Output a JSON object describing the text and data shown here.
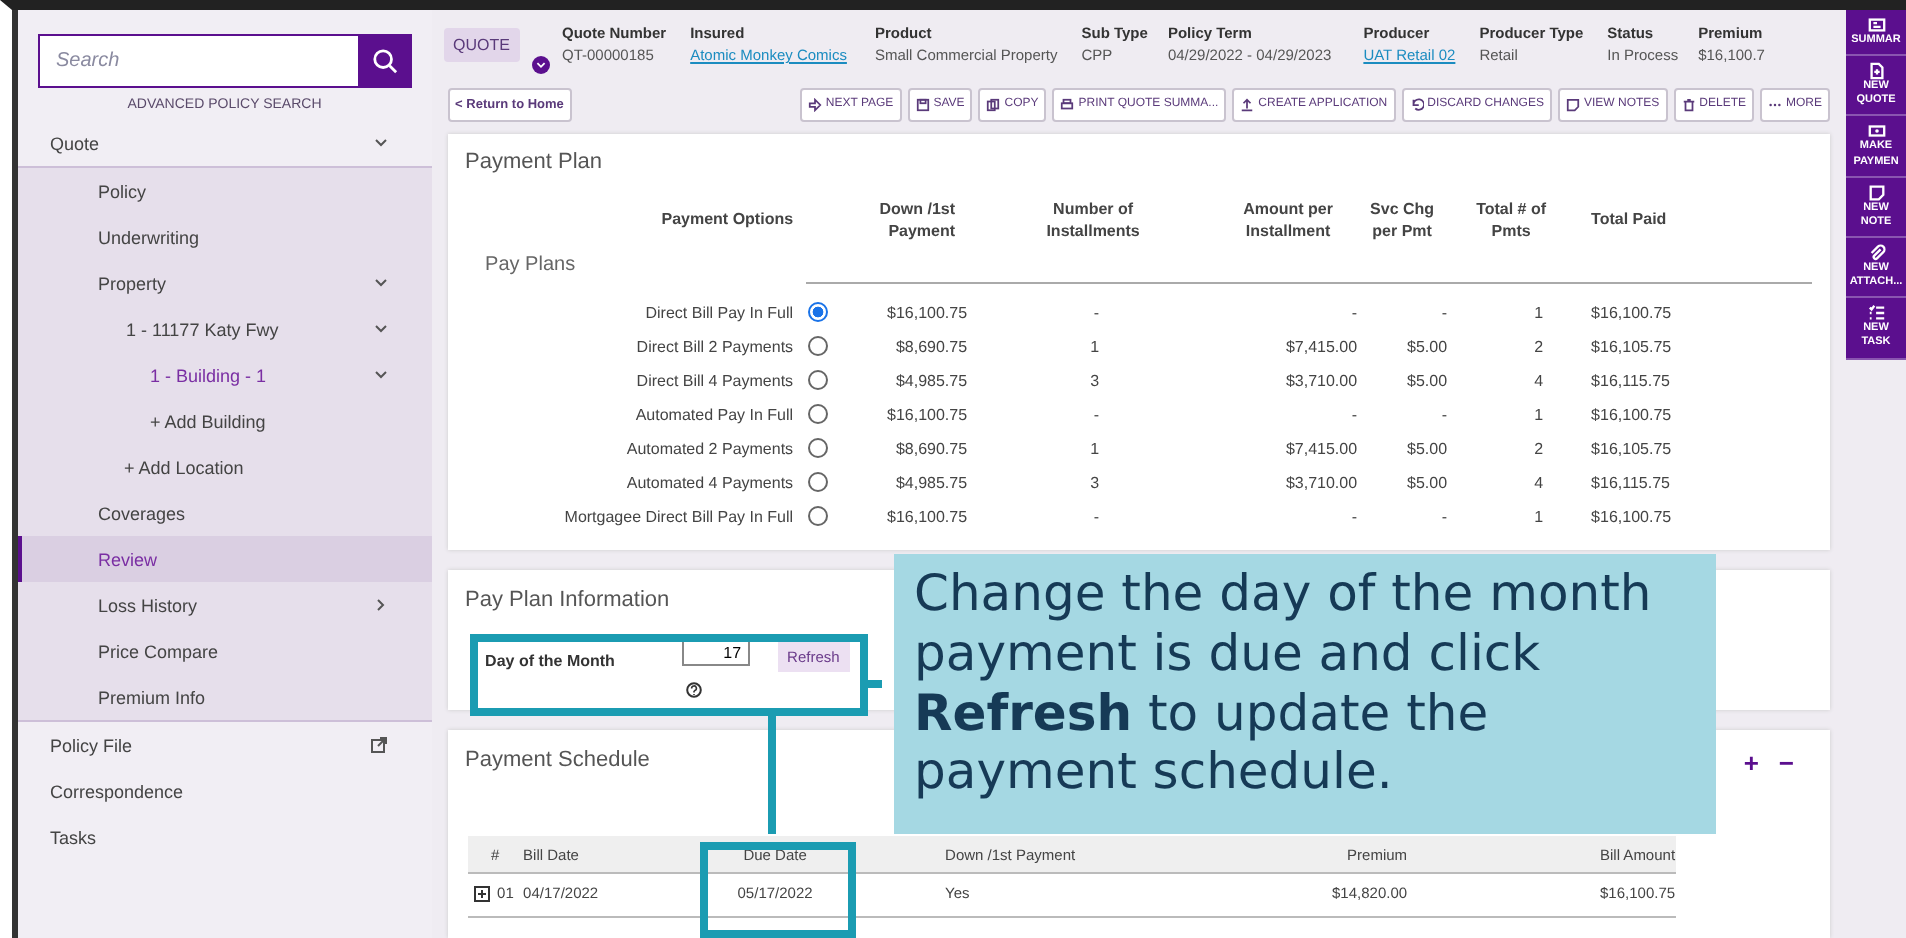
{
  "sidebar": {
    "search": {
      "placeholder": "Search"
    },
    "advanced_search": "ADVANCED POLICY SEARCH",
    "items": [
      {
        "label": "Quote",
        "expanded": true,
        "children": [
          {
            "label": "Policy",
            "selected": false
          },
          {
            "label": "Underwriting",
            "selected": false
          },
          {
            "label": "Property",
            "selected": false,
            "expanded": true,
            "children": [
              {
                "label": "1 - 11177 Katy Fwy",
                "selected": false,
                "expanded": true,
                "children": [
                  {
                    "label": "1 - Building - 1",
                    "selected": false,
                    "current": true,
                    "expanded": true
                  },
                  {
                    "label": "+ Add Building",
                    "selected": false,
                    "current": false
                  }
                ]
              },
              {
                "label": "+ Add Location",
                "selected": false
              }
            ]
          },
          {
            "label": "Coverages",
            "selected": false
          },
          {
            "label": "Review",
            "selected": true
          },
          {
            "label": "Loss History",
            "selected": false,
            "expanded": false
          },
          {
            "label": "Price Compare",
            "selected": false
          },
          {
            "label": "Premium Info",
            "selected": false
          }
        ]
      },
      {
        "label": "Policy File",
        "kind": "external"
      },
      {
        "label": "Correspondence",
        "kind": "plain"
      },
      {
        "label": "Tasks",
        "kind": "plain"
      }
    ]
  },
  "header": {
    "tag": "QUOTE",
    "fields": [
      {
        "label": "Quote Number",
        "value": "QT-00000185",
        "kind": "text"
      },
      {
        "label": "Insured",
        "value": "Atomic Monkey Comics",
        "kind": "link"
      },
      {
        "label": "Product",
        "value": "Small Commercial Property",
        "kind": "text"
      },
      {
        "label": "Sub Type",
        "value": "CPP",
        "kind": "text"
      },
      {
        "label": "Policy Term",
        "value": "04/29/2022 - 04/29/2023",
        "kind": "text"
      },
      {
        "label": "Producer",
        "value": "UAT Retail 02",
        "kind": "link"
      },
      {
        "label": "Producer Type",
        "value": "Retail",
        "kind": "text"
      },
      {
        "label": "Status",
        "value": "In Process",
        "kind": "text"
      },
      {
        "label": "Premium",
        "value": "$16,100.7",
        "kind": "text"
      }
    ]
  },
  "toolbar": {
    "back": "< Return to Home",
    "buttons": [
      "NEXT PAGE",
      "SAVE",
      "COPY",
      "PRINT QUOTE SUMMA...",
      "CREATE APPLICATION",
      "DISCARD CHANGES",
      "VIEW NOTES",
      "DELETE",
      "MORE"
    ]
  },
  "payment_plan": {
    "title": "Payment Plan",
    "subtitle": "Pay Plans",
    "columns": [
      "Payment Options",
      "Down /1st Payment",
      "Number of Installments",
      "Amount per Installment",
      "Svc Chg per Pmt",
      "Total # of Pmts",
      "Total Paid"
    ],
    "rows": [
      {
        "name": "Direct Bill Pay In Full",
        "selected": true,
        "down": "$16,100.75",
        "installments": "-",
        "amount": "-",
        "svc": "-",
        "total": "1",
        "paid": "$16,100.75"
      },
      {
        "name": "Direct Bill 2 Payments",
        "selected": false,
        "down": "$8,690.75",
        "installments": "1",
        "amount": "$7,415.00",
        "svc": "$5.00",
        "total": "2",
        "paid": "$16,105.75"
      },
      {
        "name": "Direct Bill 4 Payments",
        "selected": false,
        "down": "$4,985.75",
        "installments": "3",
        "amount": "$3,710.00",
        "svc": "$5.00",
        "total": "4",
        "paid": "$16,115.75"
      },
      {
        "name": "Automated Pay In Full",
        "selected": false,
        "down": "$16,100.75",
        "installments": "-",
        "amount": "-",
        "svc": "-",
        "total": "1",
        "paid": "$16,100.75"
      },
      {
        "name": "Automated 2 Payments",
        "selected": false,
        "down": "$8,690.75",
        "installments": "1",
        "amount": "$7,415.00",
        "svc": "$5.00",
        "total": "2",
        "paid": "$16,105.75"
      },
      {
        "name": "Automated 4 Payments",
        "selected": false,
        "down": "$4,985.75",
        "installments": "3",
        "amount": "$3,710.00",
        "svc": "$5.00",
        "total": "4",
        "paid": "$16,115.75"
      },
      {
        "name": "Mortgagee Direct Bill Pay In Full",
        "selected": false,
        "down": "$16,100.75",
        "installments": "-",
        "amount": "-",
        "svc": "-",
        "total": "1",
        "paid": "$16,100.75"
      }
    ]
  },
  "pay_plan_info": {
    "title": "Pay Plan Information",
    "day_label": "Day of the Month",
    "day_value": "17",
    "refresh": "Refresh"
  },
  "payment_schedule": {
    "title": "Payment Schedule",
    "expand": "+",
    "collapse": "−",
    "columns": [
      "#",
      "Bill Date",
      "Due Date",
      "Down /1st Payment",
      "Premium",
      "Bill Amount"
    ],
    "rows": [
      {
        "number": "01",
        "bill_date": "04/17/2022",
        "due_date": "05/17/2022",
        "down": "Yes",
        "premium": "$14,820.00",
        "bill_amount": "$16,100.75"
      }
    ]
  },
  "callout": {
    "text": "Change the day of the month payment is due and click **Refresh** to update the payment schedule."
  },
  "rail": [
    "SUMMAR",
    "NEW QUOTE",
    "MAKE PAYMEN",
    "NEW NOTE",
    "NEW ATTACH...",
    "NEW TASK"
  ]
}
